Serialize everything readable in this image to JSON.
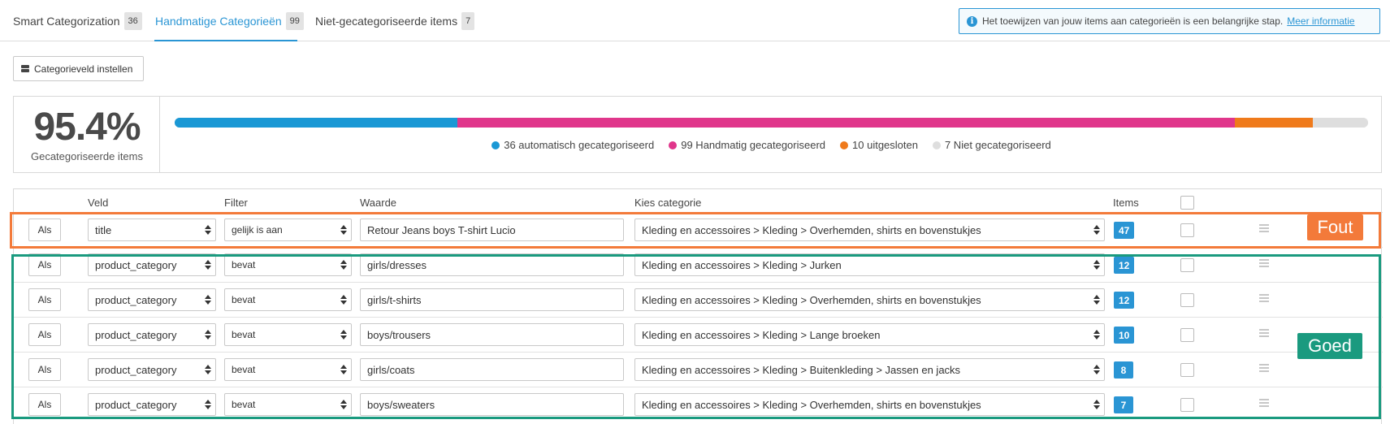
{
  "tabs": [
    {
      "label": "Smart Categorization",
      "count": "36"
    },
    {
      "label": "Handmatige Categorieën",
      "count": "99"
    },
    {
      "label": "Niet-gecategoriseerde items",
      "count": "7"
    }
  ],
  "info": {
    "text": "Het toewijzen van jouw items aan categorieën is een belangrijke stap.",
    "link": "Meer informatie"
  },
  "category_button": "Categorieveld instellen",
  "stats": {
    "percentage": "95.4%",
    "percentage_label": "Gecategoriseerde items",
    "progress": [
      {
        "label": "36 automatisch gecategoriseerd",
        "value": 36,
        "color": "#1a98d5"
      },
      {
        "label": "99 Handmatig gecategoriseerd",
        "value": 99,
        "color": "#e0368b"
      },
      {
        "label": "10 uitgesloten",
        "value": 10,
        "color": "#ef7a1b"
      },
      {
        "label": "7 Niet gecategoriseerd",
        "value": 7,
        "color": "#dedede"
      }
    ]
  },
  "table": {
    "headers": {
      "veld": "Veld",
      "filter": "Filter",
      "waarde": "Waarde",
      "categorie": "Kies categorie",
      "items": "Items"
    },
    "rows": [
      {
        "als": "Als",
        "veld": "title",
        "filter": "gelijk is aan",
        "waarde": "Retour Jeans boys T-shirt Lucio",
        "categorie": "Kleding en accessoires > Kleding > Overhemden, shirts en bovenstukjes",
        "items": "47"
      },
      {
        "als": "Als",
        "veld": "product_category",
        "filter": "bevat",
        "waarde": "girls/dresses",
        "categorie": "Kleding en accessoires > Kleding > Jurken",
        "items": "12"
      },
      {
        "als": "Als",
        "veld": "product_category",
        "filter": "bevat",
        "waarde": "girls/t-shirts",
        "categorie": "Kleding en accessoires > Kleding > Overhemden, shirts en bovenstukjes",
        "items": "12"
      },
      {
        "als": "Als",
        "veld": "product_category",
        "filter": "bevat",
        "waarde": "boys/trousers",
        "categorie": "Kleding en accessoires > Kleding > Lange broeken",
        "items": "10"
      },
      {
        "als": "Als",
        "veld": "product_category",
        "filter": "bevat",
        "waarde": "girls/coats",
        "categorie": "Kleding en accessoires > Kleding > Buitenkleding > Jassen en jacks",
        "items": "8"
      },
      {
        "als": "Als",
        "veld": "product_category",
        "filter": "bevat",
        "waarde": "boys/sweaters",
        "categorie": "Kleding en accessoires > Kleding > Overhemden, shirts en bovenstukjes",
        "items": "7"
      }
    ]
  },
  "annotations": {
    "fout": "Fout",
    "goed": "Goed"
  }
}
